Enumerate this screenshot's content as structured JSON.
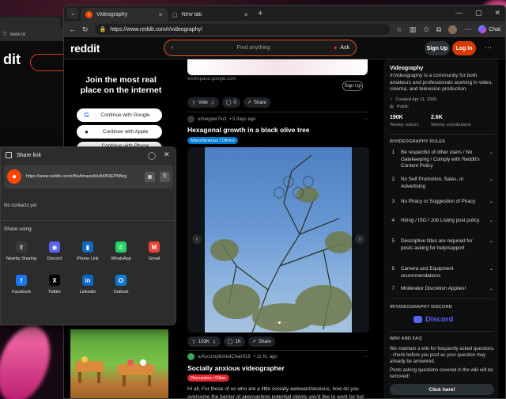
{
  "background_window": {
    "url": "www.re",
    "logo": "dit"
  },
  "browser": {
    "tabs": [
      {
        "title": "Videography",
        "active": true
      },
      {
        "title": "New tab",
        "active": false
      }
    ],
    "url": "https://www.reddit.com/r/videography/",
    "chat_label": "Chat"
  },
  "reddit_header": {
    "logo": "reddit",
    "search_placeholder": "Find anything",
    "ask_label": "Ask",
    "signup_label": "Sign Up",
    "login_label": "Log In"
  },
  "join_card": {
    "title": "Join the most real place on the internet",
    "buttons": [
      "Continue with Google",
      "Continue with Apple",
      "Continue with Phone Number"
    ]
  },
  "ad": {
    "domain": "workspace.google.com",
    "signup": "Sign Up",
    "vote_label": "Vote",
    "comments": "0",
    "share": "Share"
  },
  "post1": {
    "author": "u/toeyper7ect",
    "age": "• 5 days ago",
    "title": "Hexagonal growth in a black olive tree",
    "flair": "Miscellaneous / Others",
    "flair_color": "#0079d3",
    "votes": "103K",
    "comments": "1K",
    "share": "Share"
  },
  "post2": {
    "author": "u/AccomplishedChair918",
    "age": "• 11 hr. ago",
    "title": "Socially anxious videographer",
    "flair": "Discussion / Other",
    "flair_color": "#e0262f",
    "body": "Hi all, For those of us who are a little socially awkward/anxious, how do you overcome the barrier of approaching potential clients you'd like to work for but for some reason"
  },
  "sidebar": {
    "name": "Videography",
    "description": "/r/videography is a community for both amateurs and professionals working in video, cinema, and television production.",
    "created": "Created Apr 11, 2009",
    "visibility": "Public",
    "visitors": "190K",
    "visitors_label": "Weekly visitors",
    "contributions": "2.6K",
    "contributions_label": "Weekly contributions",
    "rules_title": "R/VIDEOGRAPHY RULES",
    "rules": [
      {
        "n": "1",
        "text": "Be respectful of other users / No Gatekeeping / Comply with Reddit's Content Policy"
      },
      {
        "n": "2",
        "text": "No Self Promotion, Sales, or Advertising"
      },
      {
        "n": "3",
        "text": "No Piracy or Suggestion of Piracy"
      },
      {
        "n": "4",
        "text": "Hiring / ISO / Job Listing post policy"
      },
      {
        "n": "5",
        "text": "Descriptive titles are required for posts asking for help/support"
      },
      {
        "n": "6",
        "text": "Camera and Equipment recommendations"
      },
      {
        "n": "7",
        "text": "Moderator Discretion Applies!"
      }
    ],
    "discord_title": "/R/VIDEOGRAPHY DISCORD",
    "discord_label": "Discord",
    "wiki_title": "WIKI AND FAQ",
    "wiki_text_1": "We maintain a wiki for frequently asked questions - check before you post as your question may already be answered.",
    "wiki_text_2": "Posts asking questions covered in the wiki will be removed!",
    "click_here": "Click here!"
  },
  "share_dialog": {
    "title": "Share link",
    "link": "https://www.reddit.com/r/BeAmazed/s/AKB3EPNNrg",
    "no_contacts": "No contacts yet",
    "share_using": "Share using",
    "apps": [
      {
        "label": "Nearby Sharing",
        "icon": "nearby-sharing-icon",
        "color": "#3a3a3a"
      },
      {
        "label": "Discord",
        "icon": "discord-icon",
        "color": "#5865f2"
      },
      {
        "label": "Phone Link",
        "icon": "phone-link-icon",
        "color": "#0f6cbd"
      },
      {
        "label": "WhatsApp",
        "icon": "whatsapp-icon",
        "color": "#25d366"
      },
      {
        "label": "Gmail",
        "icon": "gmail-icon",
        "color": "#ea4335"
      },
      {
        "label": "Facebook",
        "icon": "facebook-icon",
        "color": "#1877f2"
      },
      {
        "label": "Twitter",
        "icon": "twitter-icon",
        "color": "#000000"
      },
      {
        "label": "LinkedIn",
        "icon": "linkedin-icon",
        "color": "#0a66c2"
      },
      {
        "label": "Outlook",
        "icon": "outlook-icon",
        "color": "#0f78d4"
      }
    ]
  }
}
